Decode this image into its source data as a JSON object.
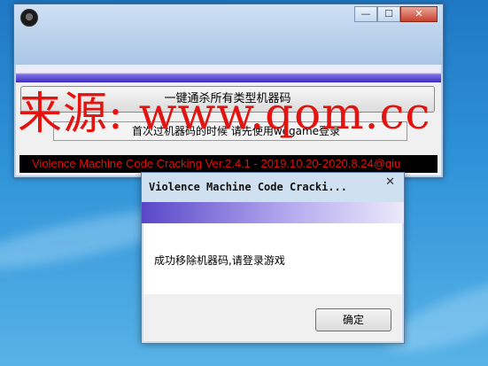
{
  "main_window": {
    "icon": "app-logo-icon",
    "controls": {
      "minimize": "—",
      "maximize": "☐",
      "close": "✕"
    },
    "crack_button_label": "一键通杀所有类型机器码",
    "hint_text": "首次过机器码的时候 请先使用wegame登录",
    "version_text": "Violence Machine Code Cracking Ver.2.4.1 - 2019.10.20-2020.8.24@qiu"
  },
  "watermark": "来源: www.qom.cc",
  "dialog": {
    "title": "Violence Machine Code Cracki...",
    "close_glyph": "✕",
    "message": "成功移除机器码,请登录游戏",
    "ok_label": "确定"
  },
  "colors": {
    "version_text": "#e0100e",
    "version_bg": "#000000",
    "watermark": "#e3130f",
    "accent_purple": "#3d2ec0"
  }
}
